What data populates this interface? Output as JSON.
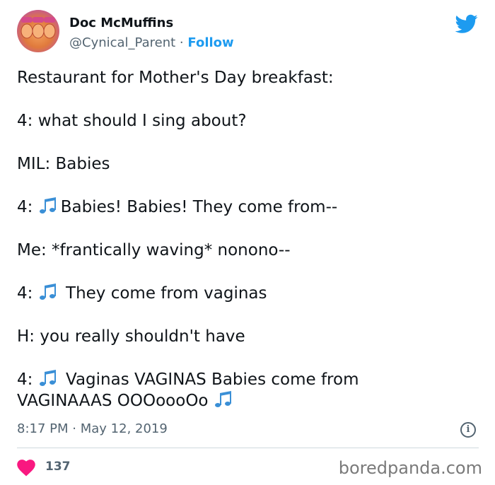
{
  "author": {
    "name": "Doc McMuffins",
    "handle": "@Cynical_Parent",
    "separator": "·",
    "follow_label": "Follow"
  },
  "tweet": {
    "lines": [
      "Restaurant for Mother's Day breakfast:",
      "4: what should I sing about?",
      "MIL: Babies",
      "Babies! Babies! They come from--",
      "Me: *frantically waving* nonono--",
      "They come from vaginas",
      "H: you really shouldn't have",
      "Vaginas VAGINAS Babies come from",
      "VAGINAAAS OOOoooOo"
    ],
    "speaker_4": "4:"
  },
  "meta": {
    "time": "8:17 PM",
    "separator": "·",
    "date": "May 12, 2019"
  },
  "engagement": {
    "likes": "137"
  },
  "watermark": "boredpanda.com",
  "icons": {
    "brand": "twitter-bird-icon",
    "note": "musical-notes-emoji",
    "like": "heart-icon",
    "info": "info-icon"
  },
  "colors": {
    "brand_blue": "#1d9bf0",
    "heart_red": "#f91880",
    "text": "#0f1419",
    "secondary": "#536471"
  }
}
